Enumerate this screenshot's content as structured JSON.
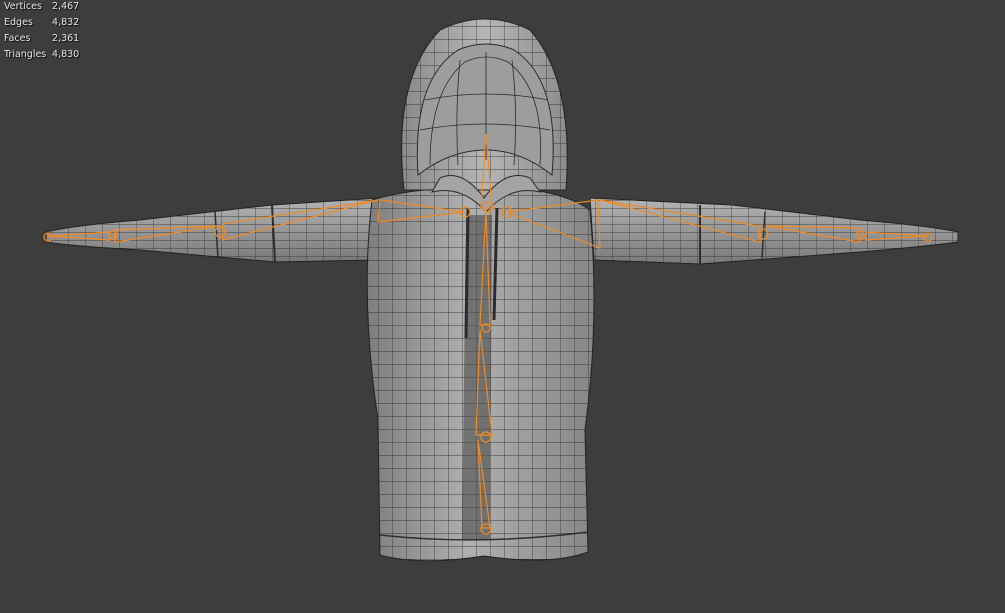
{
  "viewport": {
    "statistics": [
      {
        "label": "Vertices",
        "value": "2,467"
      },
      {
        "label": "Edges",
        "value": "4,832"
      },
      {
        "label": "Faces",
        "value": "2,361"
      },
      {
        "label": "Triangles",
        "value": "4,830"
      }
    ]
  },
  "colors": {
    "background": "#3d3d3d",
    "mesh_fill": "#9a9a9a",
    "wireframe": "#262626",
    "armature_selected": "#f08a24"
  }
}
